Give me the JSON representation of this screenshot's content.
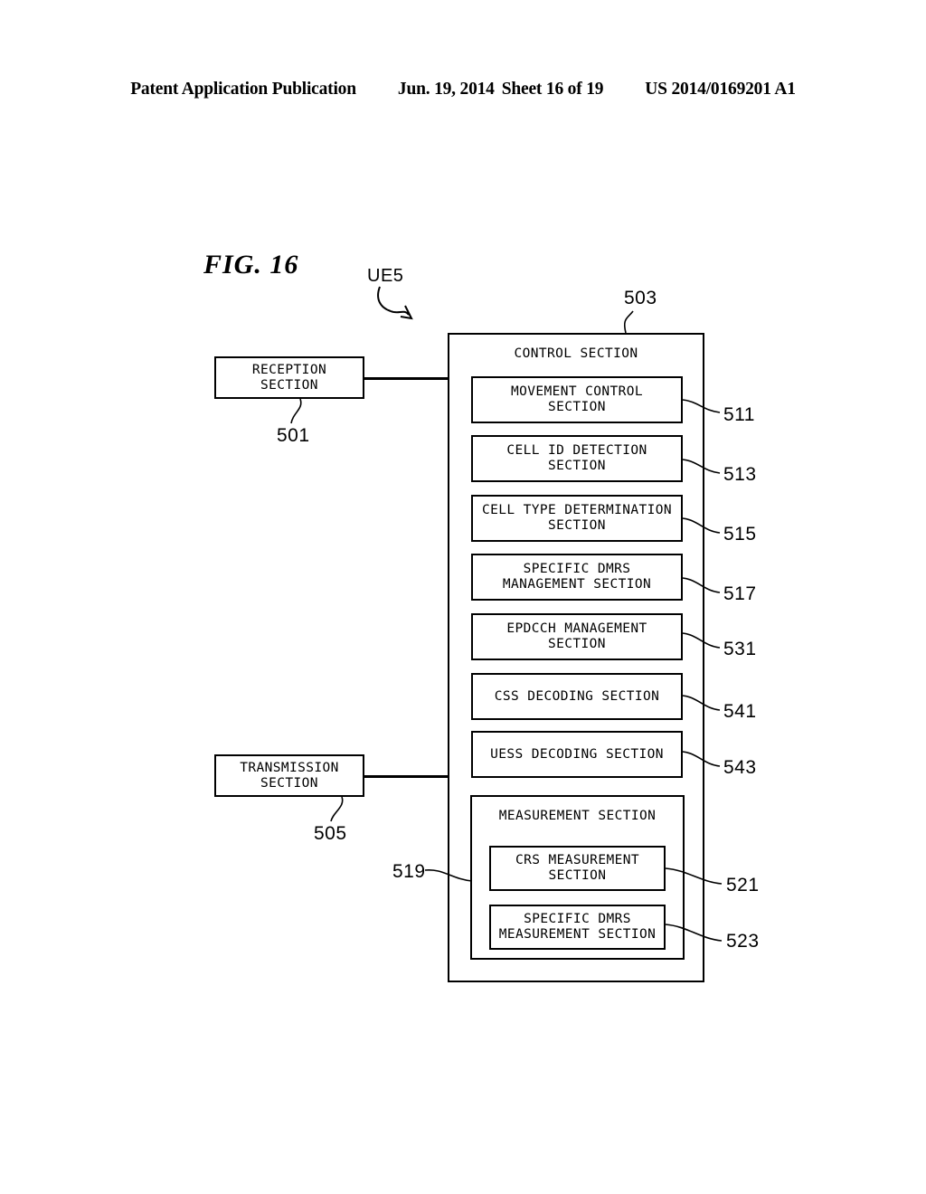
{
  "header": {
    "publication": "Patent Application Publication",
    "date": "Jun. 19, 2014",
    "sheet": "Sheet 16 of 19",
    "patent_number": "US 2014/0169201 A1"
  },
  "figure": {
    "title": "FIG. 16",
    "device_label": "UE5"
  },
  "diagram": {
    "reception": {
      "label": "RECEPTION\nSECTION",
      "ref": "501"
    },
    "transmission": {
      "label": "TRANSMISSION\nSECTION",
      "ref": "505"
    },
    "control": {
      "label": "CONTROL SECTION",
      "ref": "503"
    },
    "control_blocks": [
      {
        "label": "MOVEMENT CONTROL\nSECTION",
        "ref": "511"
      },
      {
        "label": "CELL ID DETECTION\nSECTION",
        "ref": "513"
      },
      {
        "label": "CELL TYPE DETERMINATION\nSECTION",
        "ref": "515"
      },
      {
        "label": "SPECIFIC DMRS\nMANAGEMENT SECTION",
        "ref": "517"
      },
      {
        "label": "EPDCCH MANAGEMENT\nSECTION",
        "ref": "531"
      },
      {
        "label": "CSS DECODING SECTION",
        "ref": "541"
      },
      {
        "label": "UESS DECODING SECTION",
        "ref": "543"
      }
    ],
    "measurement": {
      "label": "MEASUREMENT SECTION",
      "ref": "519",
      "blocks": [
        {
          "label": "CRS MEASUREMENT\nSECTION",
          "ref": "521"
        },
        {
          "label": "SPECIFIC DMRS\nMEASUREMENT SECTION",
          "ref": "523"
        }
      ]
    }
  },
  "colors": {
    "ink": "#000000",
    "paper": "#ffffff"
  }
}
